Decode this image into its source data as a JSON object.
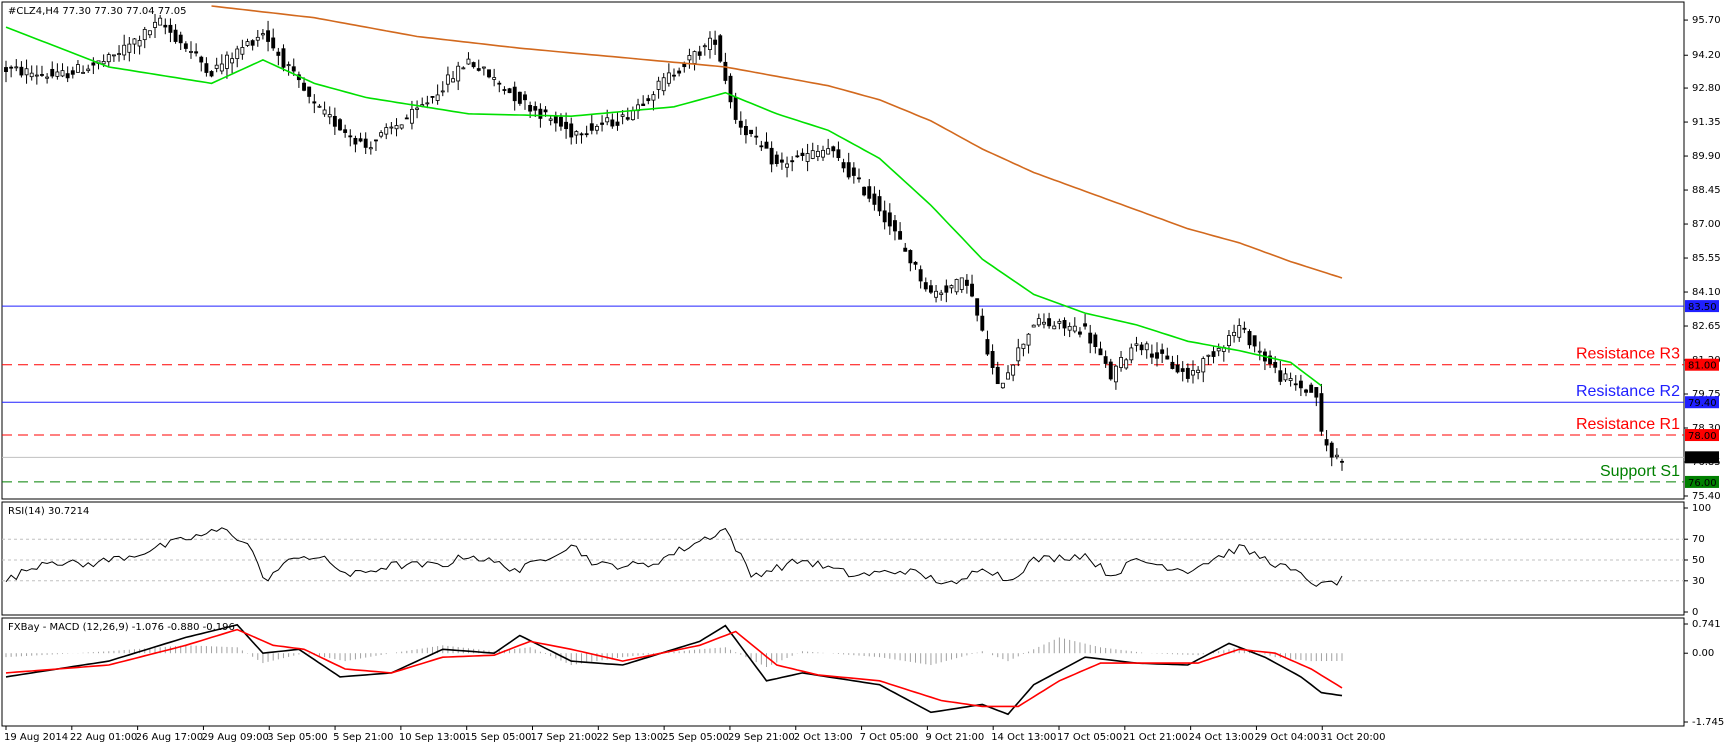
{
  "header": {
    "main": "#CLZ4,H4  77.30 77.30 77.04 77.05",
    "rsi": "RSI(14) 30.7214",
    "macd": "FXBay - MACD (12,26,9) -1.076 -0.880 -0.196"
  },
  "colors": {
    "candle_up": "#000000",
    "candle_down": "#000000",
    "ma_fast": "#00e000",
    "ma_slow": "#d2691e",
    "resistance": "#ff0000",
    "support": "#008000",
    "level_line": "#2020ff",
    "rsi_line": "#000000",
    "macd_line": "#000000",
    "signal_line": "#ff0000",
    "histogram": "#a0a0a0"
  },
  "chart_data": [
    {
      "type": "candlestick",
      "symbol": "#CLZ4",
      "timeframe": "H4",
      "ylim": [
        75.4,
        96.3
      ],
      "yticks": [
        "95.70",
        "94.20",
        "92.80",
        "91.35",
        "89.90",
        "88.45",
        "87.00",
        "85.55",
        "84.10",
        "82.65",
        "81.20",
        "79.75",
        "78.30",
        "76.85",
        "75.40"
      ],
      "xtick_labels": [
        "19 Aug 2014",
        "22 Aug 01:00",
        "26 Aug 17:00",
        "29 Aug 09:00",
        "3 Sep 05:00",
        "5 Sep 21:00",
        "10 Sep 13:00",
        "15 Sep 05:00",
        "17 Sep 21:00",
        "22 Sep 13:00",
        "25 Sep 05:00",
        "29 Sep 21:00",
        "2 Oct 13:00",
        "7 Oct 05:00",
        "9 Oct 21:00",
        "14 Oct 13:00",
        "17 Oct 05:00",
        "21 Oct 21:00",
        "24 Oct 13:00",
        "29 Oct 04:00",
        "31 Oct 20:00"
      ],
      "close_anchors": [
        [
          0,
          93.6
        ],
        [
          10,
          93.3
        ],
        [
          20,
          94.0
        ],
        [
          30,
          95.6
        ],
        [
          40,
          93.5
        ],
        [
          50,
          95.2
        ],
        [
          60,
          92.0
        ],
        [
          70,
          90.3
        ],
        [
          80,
          91.8
        ],
        [
          90,
          94.0
        ],
        [
          100,
          92.3
        ],
        [
          110,
          90.9
        ],
        [
          120,
          91.5
        ],
        [
          130,
          93.5
        ],
        [
          138,
          94.9
        ],
        [
          142,
          91.5
        ],
        [
          150,
          89.5
        ],
        [
          160,
          90.2
        ],
        [
          170,
          87.7
        ],
        [
          180,
          84.0
        ],
        [
          187,
          84.6
        ],
        [
          193,
          80.0
        ],
        [
          200,
          82.8
        ],
        [
          210,
          82.5
        ],
        [
          215,
          80.5
        ],
        [
          220,
          82.0
        ],
        [
          230,
          80.5
        ],
        [
          240,
          82.6
        ],
        [
          248,
          80.5
        ],
        [
          255,
          79.7
        ],
        [
          256,
          78.0
        ],
        [
          258,
          77.1
        ],
        [
          260,
          77.05
        ]
      ],
      "candle_count": 261,
      "ma_fast_anchors": [
        [
          0,
          95.4
        ],
        [
          20,
          93.7
        ],
        [
          40,
          93.0
        ],
        [
          50,
          94.0
        ],
        [
          60,
          93.0
        ],
        [
          70,
          92.4
        ],
        [
          90,
          91.7
        ],
        [
          110,
          91.6
        ],
        [
          130,
          92.0
        ],
        [
          140,
          92.6
        ],
        [
          150,
          91.7
        ],
        [
          160,
          91.0
        ],
        [
          170,
          89.8
        ],
        [
          180,
          87.8
        ],
        [
          190,
          85.5
        ],
        [
          200,
          84.0
        ],
        [
          210,
          83.2
        ],
        [
          220,
          82.7
        ],
        [
          230,
          82.0
        ],
        [
          240,
          81.6
        ],
        [
          250,
          81.1
        ],
        [
          256,
          80.1
        ]
      ],
      "ma_slow_anchors": [
        [
          40,
          96.3
        ],
        [
          60,
          95.8
        ],
        [
          80,
          95.0
        ],
        [
          100,
          94.5
        ],
        [
          120,
          94.1
        ],
        [
          140,
          93.7
        ],
        [
          160,
          92.9
        ],
        [
          170,
          92.3
        ],
        [
          180,
          91.4
        ],
        [
          190,
          90.2
        ],
        [
          200,
          89.2
        ],
        [
          210,
          88.4
        ],
        [
          220,
          87.6
        ],
        [
          230,
          86.8
        ],
        [
          240,
          86.2
        ],
        [
          250,
          85.4
        ],
        [
          260,
          84.7
        ]
      ],
      "levels": [
        {
          "name": "",
          "value": 83.5,
          "label": "83.50",
          "style": "solid",
          "color": "#2020ff"
        },
        {
          "name": "Resistance R3",
          "value": 81.0,
          "label": "81.00",
          "style": "dashed",
          "color": "#ff0000"
        },
        {
          "name": "Resistance R2",
          "value": 79.4,
          "label": "79.40",
          "style": "solid",
          "color": "#2020ff"
        },
        {
          "name": "Resistance R1",
          "value": 78.0,
          "label": "78.00",
          "style": "dashed",
          "color": "#ff0000"
        },
        {
          "name": "Support S1",
          "value": 76.0,
          "label": "76.00",
          "style": "dashed",
          "color": "#008000"
        }
      ],
      "current_price": {
        "value": 77.05,
        "label": "77.05"
      }
    },
    {
      "type": "line",
      "name": "RSI(14)",
      "ylim": [
        0,
        100
      ],
      "yticks": [
        "100",
        "70",
        "50",
        "30",
        "0"
      ],
      "levels": [
        70,
        50,
        30
      ],
      "anchors": [
        [
          0,
          30
        ],
        [
          8,
          50
        ],
        [
          15,
          45
        ],
        [
          25,
          55
        ],
        [
          35,
          70
        ],
        [
          43,
          80
        ],
        [
          48,
          60
        ],
        [
          50,
          30
        ],
        [
          57,
          55
        ],
        [
          62,
          50
        ],
        [
          67,
          35
        ],
        [
          75,
          45
        ],
        [
          85,
          45
        ],
        [
          90,
          55
        ],
        [
          100,
          40
        ],
        [
          110,
          65
        ],
        [
          115,
          45
        ],
        [
          125,
          45
        ],
        [
          140,
          80
        ],
        [
          145,
          35
        ],
        [
          155,
          50
        ],
        [
          165,
          35
        ],
        [
          175,
          40
        ],
        [
          185,
          25
        ],
        [
          190,
          45
        ],
        [
          195,
          30
        ],
        [
          200,
          50
        ],
        [
          210,
          55
        ],
        [
          215,
          35
        ],
        [
          220,
          50
        ],
        [
          230,
          40
        ],
        [
          240,
          62
        ],
        [
          250,
          40
        ],
        [
          256,
          25
        ],
        [
          260,
          30.7
        ]
      ]
    },
    {
      "type": "line",
      "name": "MACD (12,26,9)",
      "ylim": [
        -1.745,
        0.741
      ],
      "yticks": [
        "0.741",
        "0.00",
        "-1.745"
      ],
      "macd_anchors": [
        [
          0,
          -0.6
        ],
        [
          20,
          -0.2
        ],
        [
          35,
          0.4
        ],
        [
          45,
          0.72
        ],
        [
          50,
          0.0
        ],
        [
          57,
          0.1
        ],
        [
          65,
          -0.6
        ],
        [
          75,
          -0.5
        ],
        [
          85,
          0.1
        ],
        [
          95,
          0.0
        ],
        [
          100,
          0.45
        ],
        [
          110,
          -0.2
        ],
        [
          120,
          -0.3
        ],
        [
          135,
          0.3
        ],
        [
          140,
          0.7
        ],
        [
          148,
          -0.7
        ],
        [
          155,
          -0.5
        ],
        [
          170,
          -0.8
        ],
        [
          180,
          -1.5
        ],
        [
          190,
          -1.3
        ],
        [
          195,
          -1.55
        ],
        [
          200,
          -0.8
        ],
        [
          210,
          -0.1
        ],
        [
          220,
          -0.25
        ],
        [
          230,
          -0.3
        ],
        [
          238,
          0.25
        ],
        [
          245,
          -0.1
        ],
        [
          252,
          -0.6
        ],
        [
          256,
          -1.0
        ],
        [
          260,
          -1.076
        ]
      ],
      "signal_anchors": [
        [
          0,
          -0.5
        ],
        [
          20,
          -0.3
        ],
        [
          35,
          0.2
        ],
        [
          45,
          0.6
        ],
        [
          52,
          0.2
        ],
        [
          58,
          0.1
        ],
        [
          66,
          -0.4
        ],
        [
          75,
          -0.5
        ],
        [
          85,
          -0.1
        ],
        [
          95,
          -0.05
        ],
        [
          102,
          0.3
        ],
        [
          110,
          0.1
        ],
        [
          120,
          -0.2
        ],
        [
          135,
          0.2
        ],
        [
          142,
          0.55
        ],
        [
          150,
          -0.3
        ],
        [
          158,
          -0.55
        ],
        [
          170,
          -0.7
        ],
        [
          182,
          -1.2
        ],
        [
          190,
          -1.35
        ],
        [
          197,
          -1.35
        ],
        [
          205,
          -0.7
        ],
        [
          213,
          -0.25
        ],
        [
          222,
          -0.25
        ],
        [
          232,
          -0.25
        ],
        [
          240,
          0.1
        ],
        [
          247,
          0.0
        ],
        [
          254,
          -0.4
        ],
        [
          260,
          -0.88
        ]
      ],
      "histogram_anchors": [
        [
          0,
          -0.1
        ],
        [
          20,
          0.05
        ],
        [
          35,
          0.2
        ],
        [
          45,
          0.15
        ],
        [
          50,
          -0.25
        ],
        [
          58,
          0.0
        ],
        [
          66,
          -0.2
        ],
        [
          75,
          0.0
        ],
        [
          85,
          0.2
        ],
        [
          95,
          0.05
        ],
        [
          102,
          0.15
        ],
        [
          110,
          -0.3
        ],
        [
          120,
          -0.1
        ],
        [
          135,
          0.1
        ],
        [
          140,
          0.15
        ],
        [
          148,
          -0.35
        ],
        [
          155,
          0.05
        ],
        [
          170,
          -0.1
        ],
        [
          180,
          -0.3
        ],
        [
          190,
          0.05
        ],
        [
          195,
          -0.2
        ],
        [
          200,
          0.1
        ],
        [
          205,
          0.4
        ],
        [
          213,
          0.15
        ],
        [
          222,
          0.0
        ],
        [
          232,
          -0.05
        ],
        [
          240,
          0.15
        ],
        [
          247,
          -0.1
        ],
        [
          254,
          -0.2
        ],
        [
          260,
          -0.196
        ]
      ]
    }
  ]
}
